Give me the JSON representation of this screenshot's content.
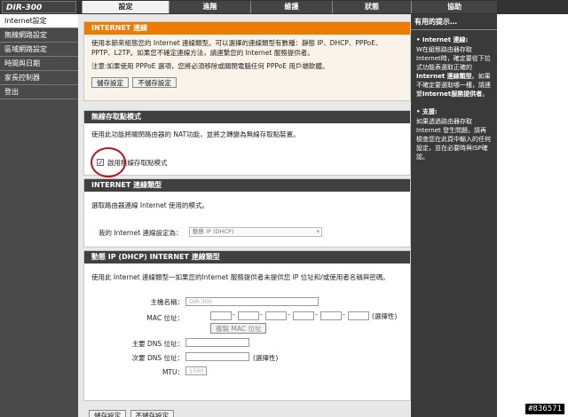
{
  "logo": "DIR-300",
  "tabs": [
    "設定",
    "進階",
    "維護",
    "狀態",
    "協助"
  ],
  "sidebar": [
    "Internet設定",
    "無線網路設定",
    "區域網路設定",
    "時間與日期",
    "家長控制器",
    "登出"
  ],
  "help": {
    "title": "有用的提示…",
    "sec1_head": "• Internet 連線:",
    "sec1_text": "W在組態路由器存取Internet時，確定要從下拉式功能表選取正確的",
    "sec1_bold": "Internet 連線類型",
    "sec1_text2": "。如果不確定要選取哪一種，請連繫",
    "sec1_bold2": "Internet服務提供者",
    "sec1_end": "。",
    "sec2_head": "• 支援:",
    "sec2_text": "如果透過路由器存取Internet 發生問題，請再檢查您在此頁中輸入的任何設定，並在必要時與ISP確認。"
  },
  "intro": {
    "title": "INTERNET 連線",
    "text": "使用本節來組態您的 Internet 連線類型。可以選擇的連線類型有數種：靜態 IP、DHCP、PPPoE、PPTP、L2TP。如果您不確定連線方法，請連繫您的 Internet 服務提供者。",
    "note": "注意:如果使用 PPPoE 選項，您將必須移除或關閉電腦任何 PPPoE 用戶端軟體。",
    "save": "儲存設定",
    "nosave": "不儲存設定"
  },
  "wizard": {
    "title": "無線存取點模式",
    "text": "使用此功能將關閉路由器的 NAT功能，並將之轉變為無線存取點裝置。",
    "checkbox_label": "啟用無線存取點模式",
    "checked": true
  },
  "conn_type": {
    "title": "INTERNET 連線類型",
    "text": "選取路由器連線 Internet 使用的模式。",
    "label": "我的 Internet 連線設定為：",
    "value": "動態 IP (DHCP)"
  },
  "dhcp": {
    "title": "動態 IP (DHCP) INTERNET 連線類型",
    "text": "使用此 Internet 連線類型一如果您的Internet 服務提供者未提供您 IP 位址和/或使用者名稱與密碼。",
    "host_label": "主機名稱：",
    "host_value": "DIR-300",
    "mac_label": "MAC 位址：",
    "mac_optional": "(選擇性)",
    "clone_btn": "複製 MAC 位址",
    "dns1_label": "主要 DNS 位址：",
    "dns2_label": "次要 DNS 位址：",
    "dns2_optional": "(選擇性)",
    "mtu_label": "MTU：",
    "mtu_value": "1500"
  },
  "bottom": {
    "save": "儲存設定",
    "nosave": "不儲存設定"
  },
  "watermark": "#836571"
}
